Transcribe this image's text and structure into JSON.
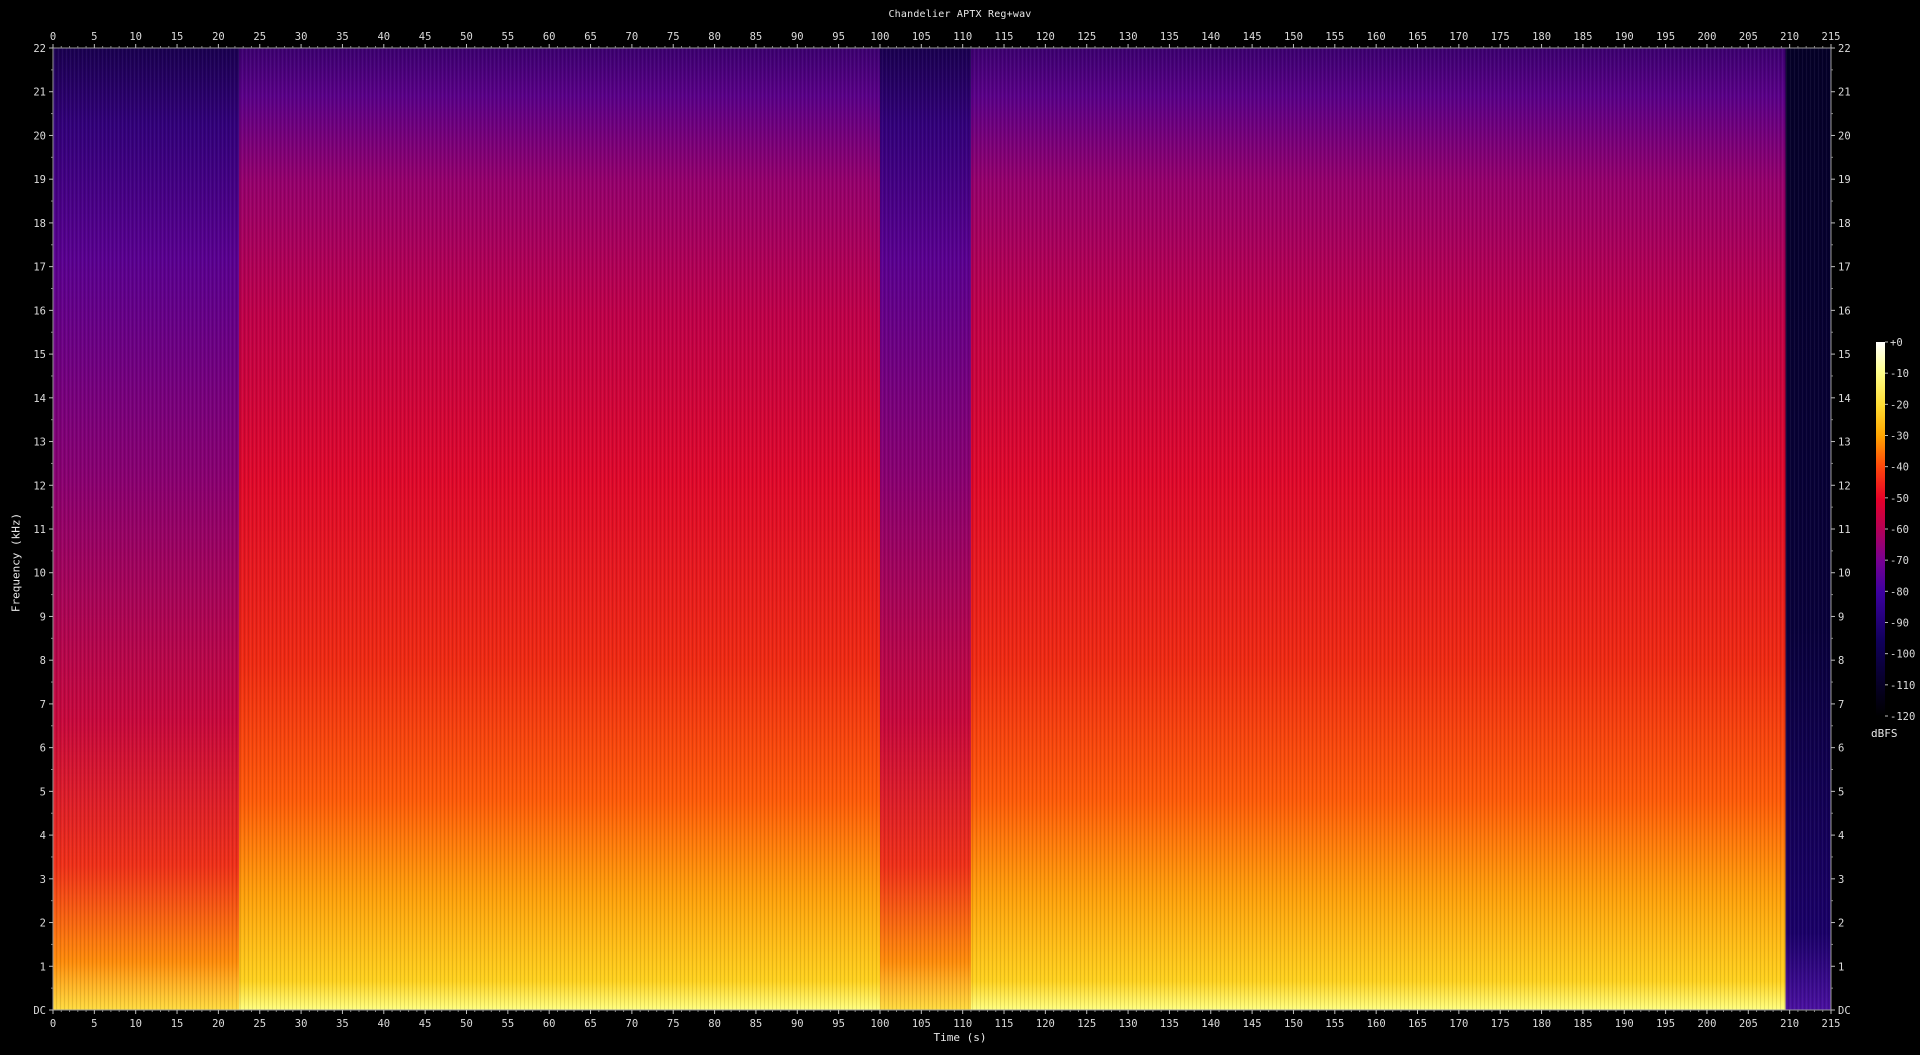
{
  "chart_data": {
    "type": "heatmap",
    "title": "Chandelier APTX Reg+wav",
    "xlabel": "Time (s)",
    "ylabel": "Frequency (kHz)",
    "xlim": [
      0,
      215
    ],
    "ylim": [
      0,
      22
    ],
    "x_ticks": [
      0,
      5,
      10,
      15,
      20,
      25,
      30,
      35,
      40,
      45,
      50,
      55,
      60,
      65,
      70,
      75,
      80,
      85,
      90,
      95,
      100,
      105,
      110,
      115,
      120,
      125,
      130,
      135,
      140,
      145,
      150,
      155,
      160,
      165,
      170,
      175,
      180,
      185,
      190,
      195,
      200,
      205,
      210,
      215
    ],
    "y_ticks": [
      {
        "v": 0,
        "label": "DC"
      },
      {
        "v": 1,
        "label": "1"
      },
      {
        "v": 2,
        "label": "2"
      },
      {
        "v": 3,
        "label": "3"
      },
      {
        "v": 4,
        "label": "4"
      },
      {
        "v": 5,
        "label": "5"
      },
      {
        "v": 6,
        "label": "6"
      },
      {
        "v": 7,
        "label": "7"
      },
      {
        "v": 8,
        "label": "8"
      },
      {
        "v": 9,
        "label": "9"
      },
      {
        "v": 10,
        "label": "10"
      },
      {
        "v": 11,
        "label": "11"
      },
      {
        "v": 12,
        "label": "12"
      },
      {
        "v": 13,
        "label": "13"
      },
      {
        "v": 14,
        "label": "14"
      },
      {
        "v": 15,
        "label": "15"
      },
      {
        "v": 16,
        "label": "16"
      },
      {
        "v": 17,
        "label": "17"
      },
      {
        "v": 18,
        "label": "18"
      },
      {
        "v": 19,
        "label": "19"
      },
      {
        "v": 20,
        "label": "20"
      },
      {
        "v": 21,
        "label": "21"
      },
      {
        "v": 22,
        "label": "22"
      }
    ],
    "colorbar": {
      "unit": "dBFS",
      "range": [
        -120,
        0
      ],
      "ticks": [
        "+0",
        "-10",
        "-20",
        "-30",
        "-40",
        "-50",
        "-60",
        "-70",
        "-80",
        "-90",
        "-100",
        "-110",
        "-120"
      ],
      "colormap": [
        "#ffffff",
        "#ffff8c",
        "#ffdc32",
        "#ffa500",
        "#ff4a0a",
        "#e60028",
        "#b40055",
        "#7a0090",
        "#3c00a0",
        "#10005a",
        "#000000"
      ]
    },
    "segments": [
      {
        "t0": 0,
        "t1": 22.5,
        "level": "quiet"
      },
      {
        "t0": 22.5,
        "t1": 100,
        "level": "loud"
      },
      {
        "t0": 100,
        "t1": 111,
        "level": "quiet"
      },
      {
        "t0": 111,
        "t1": 209.5,
        "level": "loud"
      },
      {
        "t0": 209.5,
        "t1": 215,
        "level": "silence"
      }
    ]
  }
}
